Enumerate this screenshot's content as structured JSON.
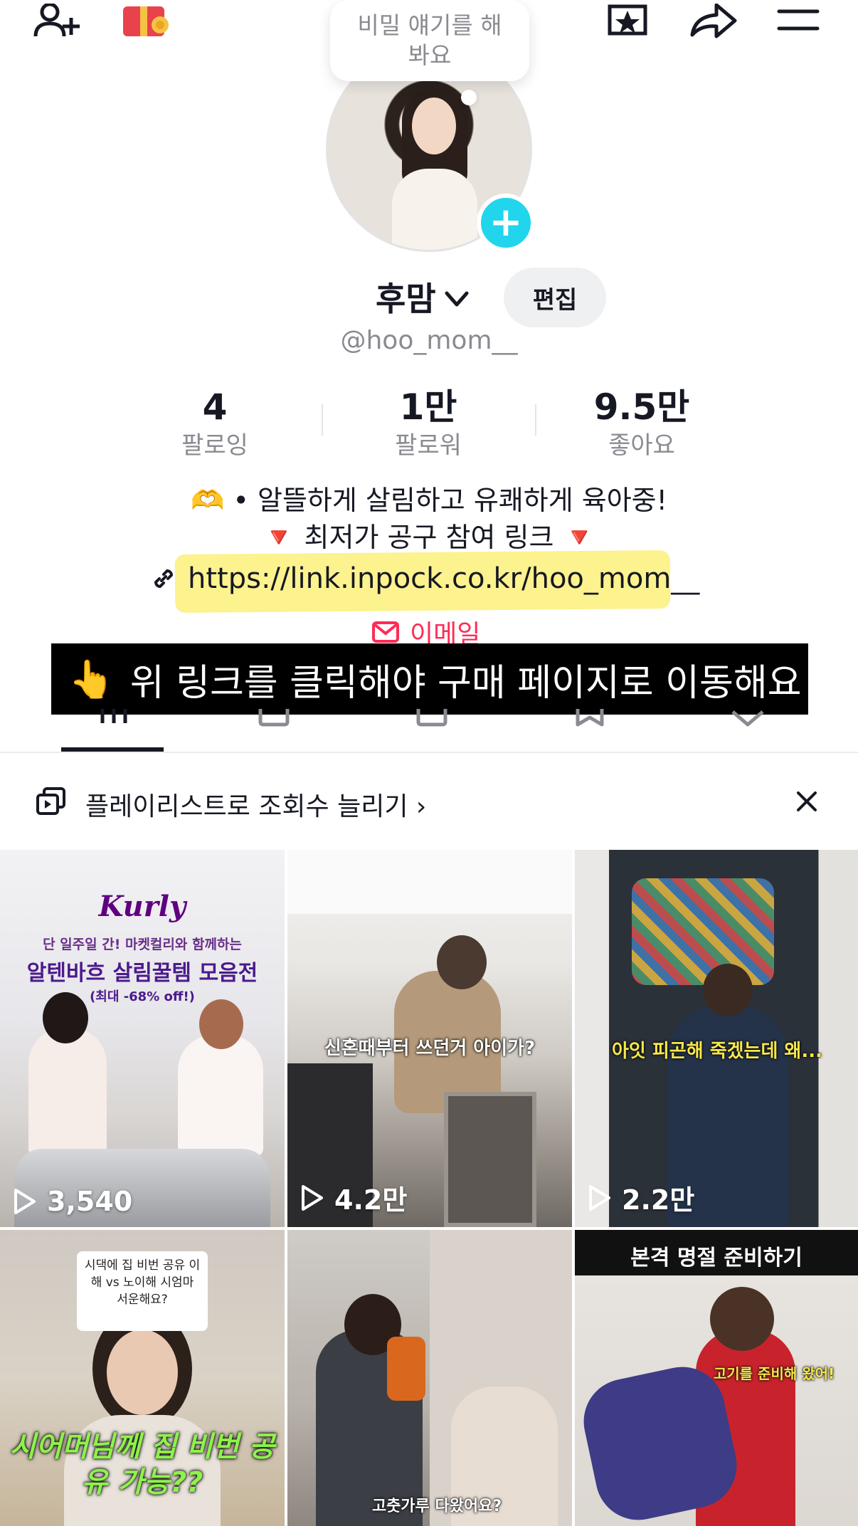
{
  "top_bar": {
    "icons": [
      "add-friend-icon",
      "gift-icon",
      "favorites-icon",
      "share-icon",
      "menu-icon"
    ]
  },
  "bubble": {
    "text": "비밀 얘기를 해 봐요"
  },
  "profile": {
    "name": "후맘",
    "edit_label": "편집",
    "handle": "@hoo_mom__"
  },
  "stats": [
    {
      "value": "4",
      "label": "팔로잉"
    },
    {
      "value": "1만",
      "label": "팔로워"
    },
    {
      "value": "9.5만",
      "label": "좋아요"
    }
  ],
  "bio": {
    "line1": "🫶 • 알뜰하게 살림하고 유쾌하게 육아중!",
    "line2": "🔻  최저가 공구 참여 링크 🔻",
    "link": "https://link.inpock.co.kr/hoo_mom__",
    "email_label": "이메일"
  },
  "banner": {
    "hand": "👆",
    "text": "위 링크를 클릭해야 구매 페이지로 이동해요"
  },
  "tabs": [
    "videos-tab",
    "shop-tab",
    "reposts-tab",
    "saved-tab",
    "liked-tab"
  ],
  "playlist": {
    "text": "플레이리스트로 조회수 늘리기 ›"
  },
  "videos": [
    {
      "views": "3,540",
      "logo": "Kurly",
      "caption_top": "단 일주일 간! 마켓컬리와 함께하는",
      "caption_main": "알텐바흐 살림꿀템 모음전",
      "caption_sub": "(최대 -68% off!)"
    },
    {
      "views": "4.2만",
      "caption": "신혼때부터 쓰던거 아이가?"
    },
    {
      "views": "2.2만",
      "caption": "아잇 피곤해 죽겠는데 왜..."
    },
    {
      "caption_box": "시댁에 집 비번 공유 이해 vs 노이해 시엄마 서운해요?",
      "caption_main": "시어머님께 집 비번 공유 가능??"
    },
    {
      "caption": "고춧가루 다왔어요?"
    },
    {
      "caption_top": "본격 명절 준비하기",
      "caption": "고기를 준비해 왔어!"
    }
  ],
  "colors": {
    "accent": "#fe2c55",
    "badge": "#20d5ec",
    "highlight": "#fbf07a"
  }
}
